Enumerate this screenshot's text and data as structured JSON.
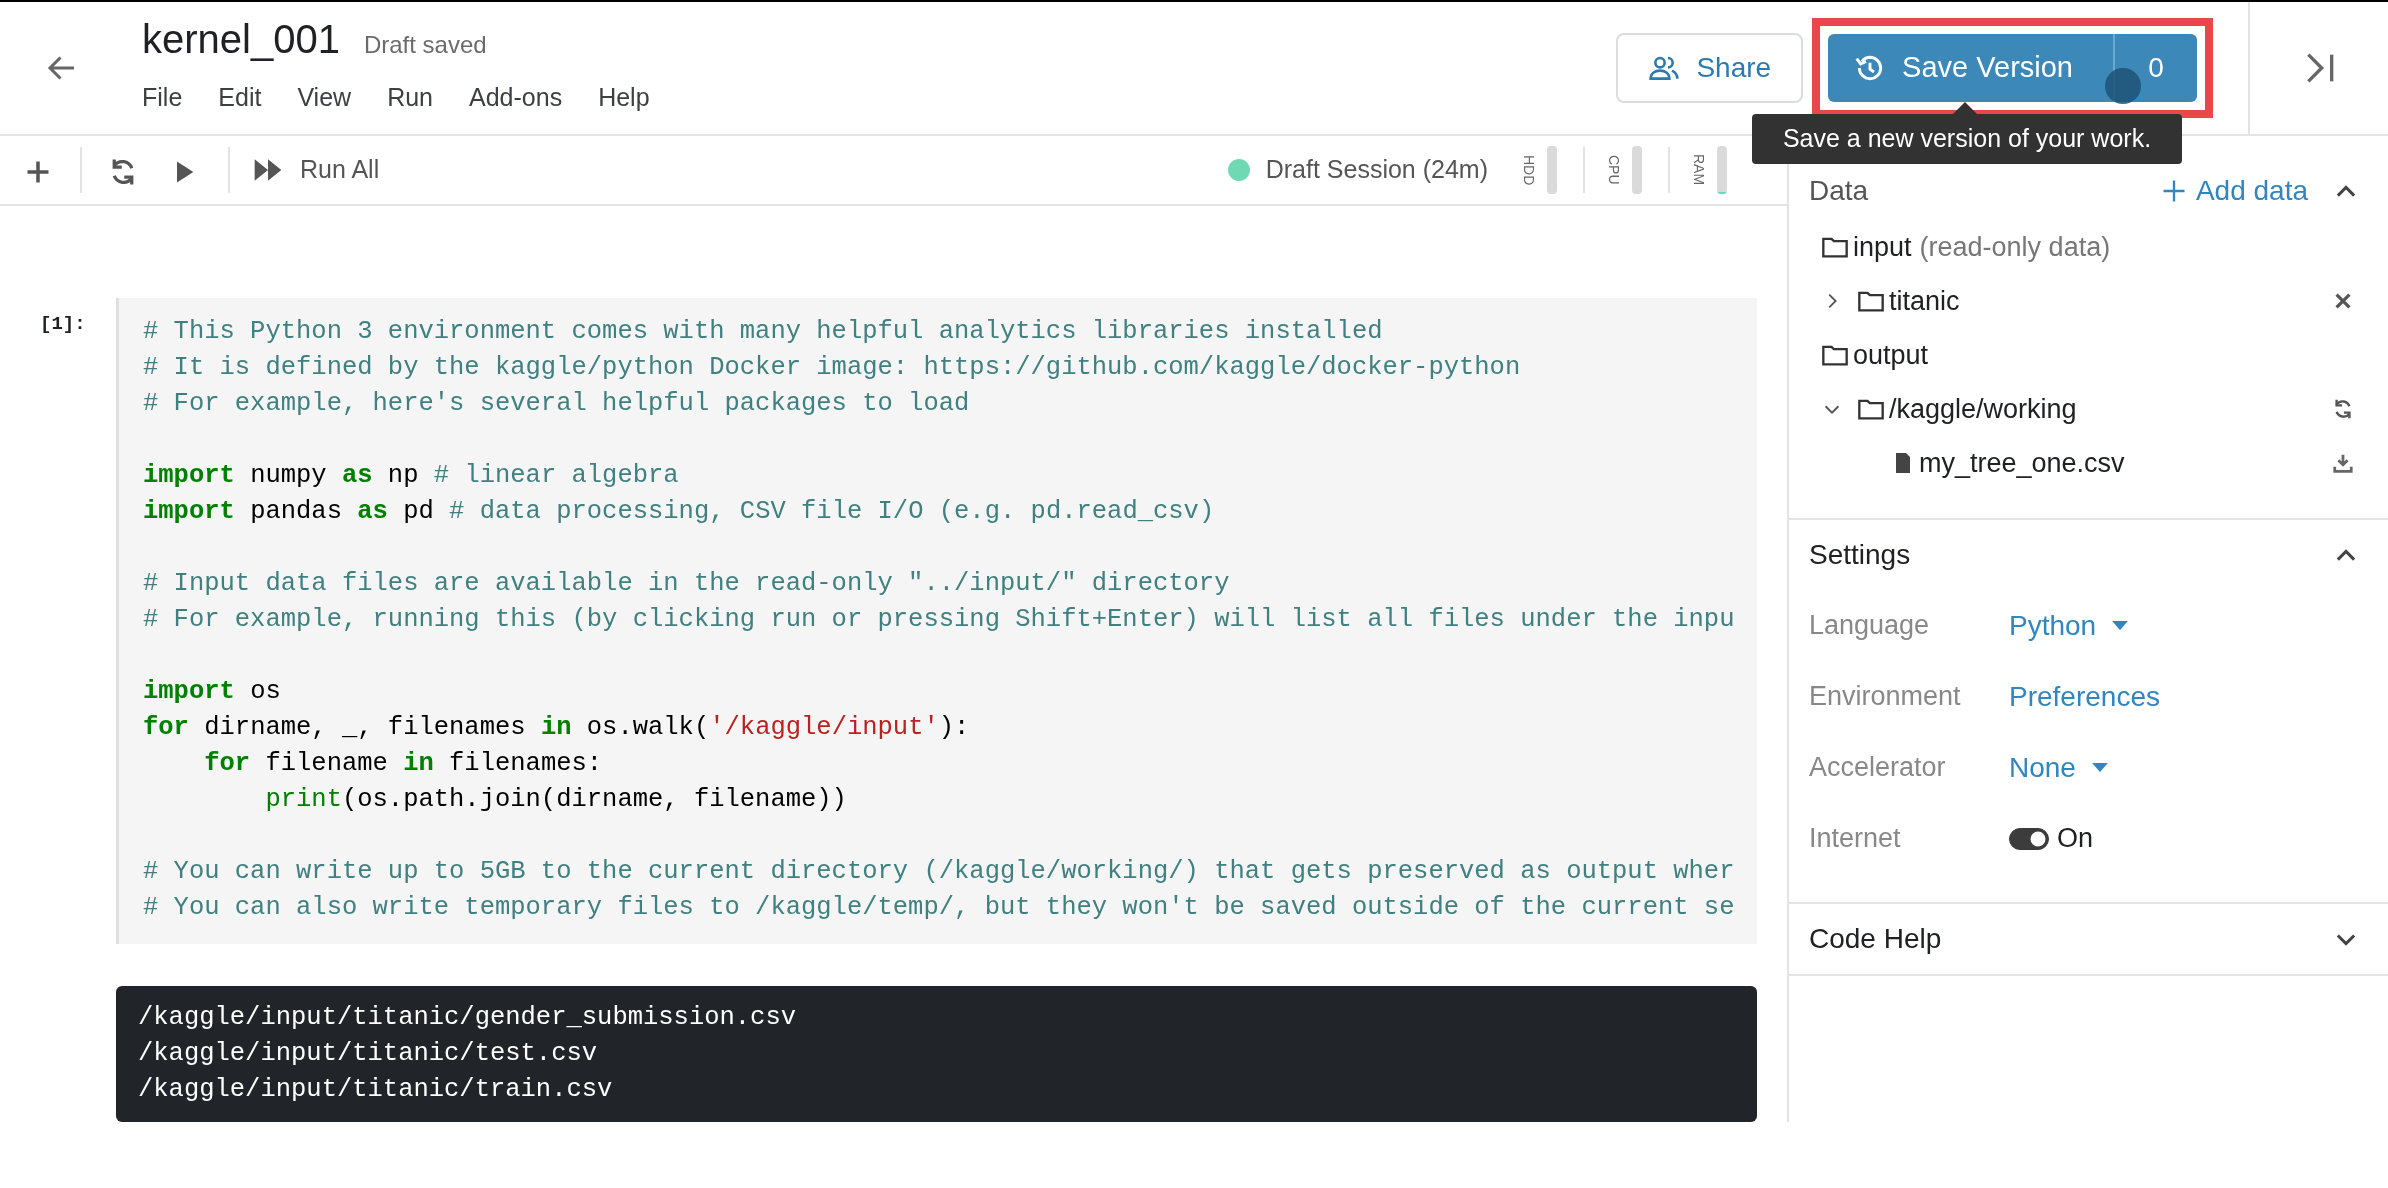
{
  "header": {
    "title": "kernel_001",
    "status": "Draft saved",
    "menu": [
      "File",
      "Edit",
      "View",
      "Run",
      "Add-ons",
      "Help"
    ],
    "share_label": "Share",
    "save_label": "Save Version",
    "version_count": "0",
    "tooltip": "Save a new version of your work."
  },
  "toolbar": {
    "run_all": "Run All",
    "session": "Draft Session (24m)",
    "meters": [
      {
        "label": "HDD",
        "level": 0
      },
      {
        "label": "CPU",
        "level": 0
      },
      {
        "label": "RAM",
        "level": 0.05
      }
    ]
  },
  "cell": {
    "prompt": "[1]:",
    "blocks": [
      [
        [
          {
            "kind": "comment",
            "text": "# This Python 3 environment comes with many helpful analytics libraries installed"
          }
        ],
        [
          {
            "kind": "comment",
            "text": "# It is defined by the kaggle/python Docker image: https://github.com/kaggle/docker-python"
          }
        ],
        [
          {
            "kind": "comment",
            "text": "# For example, here's several helpful packages to load"
          }
        ]
      ],
      [
        [
          {
            "kind": "keyword",
            "text": "import"
          },
          {
            "kind": "plain",
            "text": " numpy "
          },
          {
            "kind": "keyword",
            "text": "as"
          },
          {
            "kind": "plain",
            "text": " np "
          },
          {
            "kind": "comment",
            "text": "# linear algebra"
          }
        ],
        [
          {
            "kind": "keyword",
            "text": "import"
          },
          {
            "kind": "plain",
            "text": " pandas "
          },
          {
            "kind": "keyword",
            "text": "as"
          },
          {
            "kind": "plain",
            "text": " pd "
          },
          {
            "kind": "comment",
            "text": "# data processing, CSV file I/O (e.g. pd.read_csv)"
          }
        ]
      ],
      [
        [
          {
            "kind": "comment",
            "text": "# Input data files are available in the read-only \"../input/\" directory"
          }
        ],
        [
          {
            "kind": "comment",
            "text": "# For example, running this (by clicking run or pressing Shift+Enter) will list all files under the inpu"
          }
        ]
      ],
      [
        [
          {
            "kind": "keyword",
            "text": "import"
          },
          {
            "kind": "plain",
            "text": " os"
          }
        ],
        [
          {
            "kind": "keyword",
            "text": "for"
          },
          {
            "kind": "plain",
            "text": " dirname, _, filenames "
          },
          {
            "kind": "keyword",
            "text": "in"
          },
          {
            "kind": "plain",
            "text": " os.walk("
          },
          {
            "kind": "string",
            "text": "'/kaggle/input'"
          },
          {
            "kind": "plain",
            "text": "):"
          }
        ],
        [
          {
            "kind": "keyword",
            "text": "    for"
          },
          {
            "kind": "plain",
            "text": " filename "
          },
          {
            "kind": "keyword",
            "text": "in"
          },
          {
            "kind": "plain",
            "text": " filenames:"
          }
        ],
        [
          {
            "kind": "builtin",
            "text": "        print"
          },
          {
            "kind": "plain",
            "text": "(os.path.join(dirname, filename))"
          }
        ]
      ],
      [
        [
          {
            "kind": "comment",
            "text": "# You can write up to 5GB to the current directory (/kaggle/working/) that gets preserved as output wher"
          }
        ],
        [
          {
            "kind": "comment",
            "text": "# You can also write temporary files to /kaggle/temp/, but they won't be saved outside of the current se"
          }
        ]
      ]
    ],
    "output": [
      "/kaggle/input/titanic/gender_submission.csv",
      "/kaggle/input/titanic/test.csv",
      "/kaggle/input/titanic/train.csv"
    ]
  },
  "sidebar": {
    "data": {
      "title": "Data",
      "add_label": "Add data",
      "expanded": true,
      "tree": [
        {
          "kind": "root",
          "name": "input",
          "note": "(read-only data)",
          "children": [
            {
              "kind": "folder",
              "name": "titanic",
              "expanded": false,
              "removable": true
            }
          ]
        },
        {
          "kind": "root",
          "name": "output",
          "children": [
            {
              "kind": "folder",
              "name": "/kaggle/working",
              "expanded": true,
              "refreshable": true,
              "children": [
                {
                  "kind": "file",
                  "name": "my_tree_one.csv",
                  "downloadable": true
                }
              ]
            }
          ]
        }
      ]
    },
    "settings": {
      "title": "Settings",
      "expanded": true,
      "rows": [
        {
          "label": "Language",
          "kind": "dropdown",
          "value": "Python"
        },
        {
          "label": "Environment",
          "kind": "link",
          "value": "Preferences"
        },
        {
          "label": "Accelerator",
          "kind": "dropdown",
          "value": "None"
        },
        {
          "label": "Internet",
          "kind": "switch",
          "value": "On",
          "on": true
        }
      ]
    },
    "code_help": {
      "title": "Code Help",
      "expanded": false
    }
  }
}
